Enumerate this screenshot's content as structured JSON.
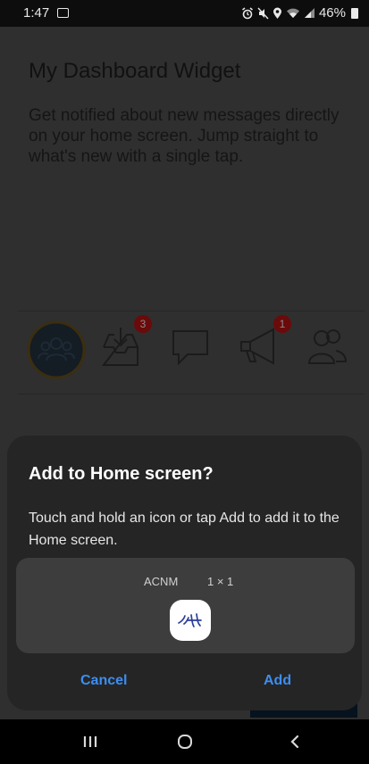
{
  "status_bar": {
    "time": "1:47",
    "battery": "46%",
    "icons": [
      "gallery-icon",
      "alarm-icon",
      "mute-icon",
      "location-icon",
      "wifi-icon",
      "signal-icon",
      "battery-icon"
    ]
  },
  "background": {
    "title": "My Dashboard Widget",
    "description": "Get notified about new messages directly on your home screen. Jump straight to what's new with a single tap.",
    "badges": {
      "inbox": "3",
      "announcements": "1"
    }
  },
  "dialog": {
    "title": "Add to Home screen?",
    "description": "Touch and hold an icon or tap Add to add it to the Home screen.",
    "widget_name": "ACNM",
    "widget_size": "1 × 1",
    "cancel_label": "Cancel",
    "add_label": "Add"
  },
  "colors": {
    "accent": "#3d8ef0",
    "sheet": "#252525",
    "preview": "#3d3d3d"
  },
  "nav_bar": {
    "icons": [
      "recents-icon",
      "home-icon",
      "back-icon"
    ]
  }
}
